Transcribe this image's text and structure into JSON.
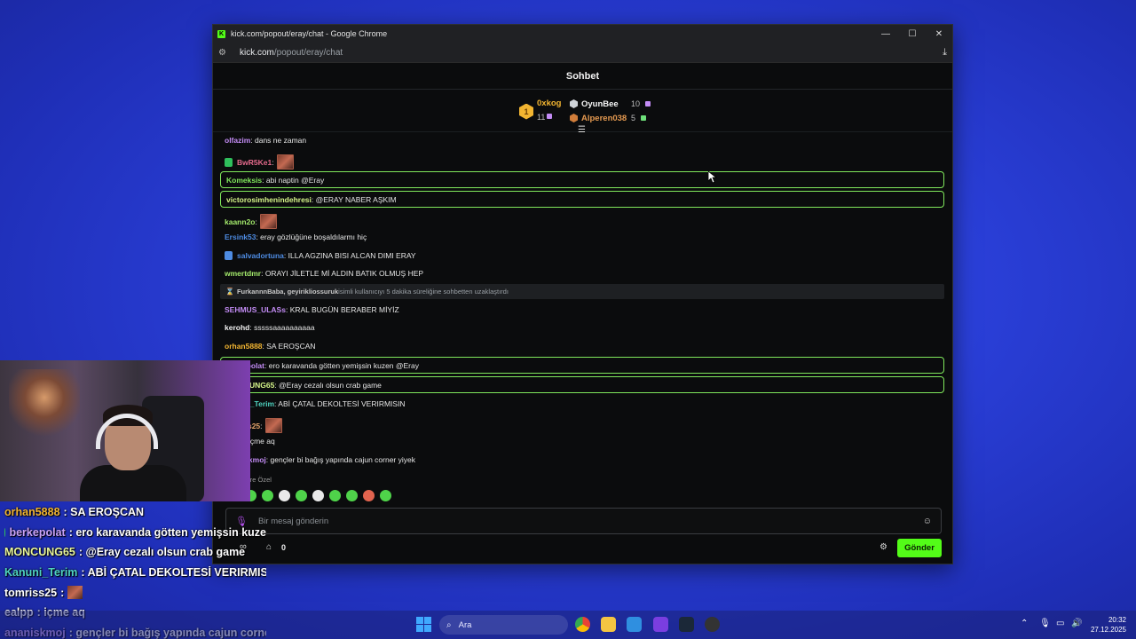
{
  "window": {
    "title": "kick.com/popout/eray/chat - Google Chrome",
    "url_host": "kick.com",
    "url_path": "/popout/eray/chat"
  },
  "chat": {
    "header": "Sohbet",
    "leaderboard": {
      "first": {
        "rank": "1",
        "name": "0xkog",
        "count": "11"
      },
      "second": {
        "name": "OyunBee",
        "count": "10"
      },
      "third": {
        "name": "Alperen038",
        "count": "5"
      }
    },
    "messages": [
      {
        "user": "olfazim",
        "text": ": dans ne zaman",
        "color": "#c38cf5",
        "top": 0
      },
      {
        "user": "BwR5Ke1",
        "text": ":",
        "color": "#e46a8c",
        "badge": "green",
        "emote": true
      },
      {
        "user": "Komeksis",
        "text": ": abi naptin @Eray",
        "color": "#80e85c",
        "hl": true
      },
      {
        "user": "victorosimhenindehresi",
        "text": ": @ERAY NABER AŞKIM",
        "color": "#d7f78a",
        "hl": true
      },
      {
        "user": "kaann2o",
        "text": ":",
        "color": "#a3e96b",
        "emote": true
      },
      {
        "user": "Ersink53",
        "text": ": eray gözlüğüne boşaldılarmı hiç",
        "color": "#4e8ce3"
      },
      {
        "user": "salvadortuna",
        "text": ": ILLA AGZINA BISI ALCAN DIMI ERAY",
        "color": "#4e8ce3",
        "badge": "blue"
      },
      {
        "user": "wmertdmr",
        "text": ": ORAYI JİLETLE Mİ ALDIN BATIK OLMUŞ HEP",
        "color": "#a3e96b"
      },
      {
        "user": "FurkannnBaba, geyirikliossuruk",
        "text": " isimli kullanıcıyı 5 dakika süreliğine sohbetten uzaklaştırdı",
        "sys": true
      },
      {
        "user": "SEHMUS_ULASs",
        "text": ": KRAL BUGÜN BERABER MİYİZ",
        "color": "#c38cf5"
      },
      {
        "user": "kerohd",
        "text": ": sssssaaaaaaaaaa",
        "color": "#f1f1f1"
      },
      {
        "user": "orhan5888",
        "text": ": SA EROŞCAN",
        "color": "#f2b531"
      },
      {
        "user": "berkepolat",
        "text": ": ero karavanda götten yemişsin kuzen @Eray",
        "color": "#c38cf5",
        "hl": true
      },
      {
        "user": "MONCUNG65",
        "text": ": @Eray cezalı olsun crab game",
        "color": "#d7f78a",
        "hl": true
      },
      {
        "user": "Kanuni_Terim",
        "text": ": ABİ ÇATAL DEKOLTESİ VERIRMISIN",
        "color": "#4fd3c0"
      },
      {
        "user": "tomriss25",
        "text": ":",
        "color": "#e6a46b",
        "emote": true
      },
      {
        "user": "ealpp",
        "text": ": içme aq",
        "color": "#f1f1f1"
      },
      {
        "user": "ananiskmoj",
        "text": ": gençler bi bağış yapında cajun corner yiyek",
        "color": "#c38cf5"
      }
    ],
    "emote_section": "Takipçilere Özel",
    "input_placeholder": "Bir mesaj gönderin",
    "store_count": "0",
    "send_label": "Gönder"
  },
  "overlay": [
    {
      "user": "orhan5888",
      "text": ": SA EROŞCAN",
      "color": "#f2b531"
    },
    {
      "user": "berkepolat",
      "text": ": ero karavanda götten yemişsin kuze",
      "color": "#c9a2f7",
      "badge": true
    },
    {
      "user": "MONCUNG65",
      "text": ": @Eray cezalı olsun crab game",
      "color": "#e8f59a"
    },
    {
      "user": "Kanuni_Terim",
      "text": ": ABİ ÇATAL DEKOLTESİ VERIRMISIN",
      "color": "#4fd3c0"
    },
    {
      "user": "tomriss25",
      "text": ":",
      "color": "#ffffff",
      "emote": true
    },
    {
      "user": "ealpp",
      "text": ": içme aq",
      "color": "#ffffff"
    },
    {
      "user": "ananiskmoj",
      "text": ": gençler bi bağış yapında cajun corner",
      "color": "#c9a2f7"
    }
  ],
  "taskbar": {
    "search_label": "Ara",
    "time": "20:32",
    "date": "27.12.2025"
  }
}
